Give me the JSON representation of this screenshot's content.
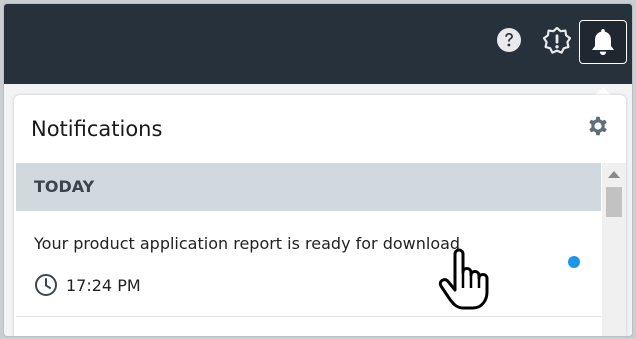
{
  "topbar": {
    "icons": [
      "help-icon",
      "alert-icon",
      "bell-icon"
    ]
  },
  "notifications": {
    "title": "Notifications",
    "settings_icon": "gear-icon",
    "section": "TODAY",
    "items": [
      {
        "text": "Your product application report is ready for download",
        "time": "17:24 PM",
        "unread": true
      }
    ]
  },
  "colors": {
    "topbar_bg": "#27313b",
    "section_bg": "#d1d8de",
    "unread_dot": "#1e96e8"
  }
}
